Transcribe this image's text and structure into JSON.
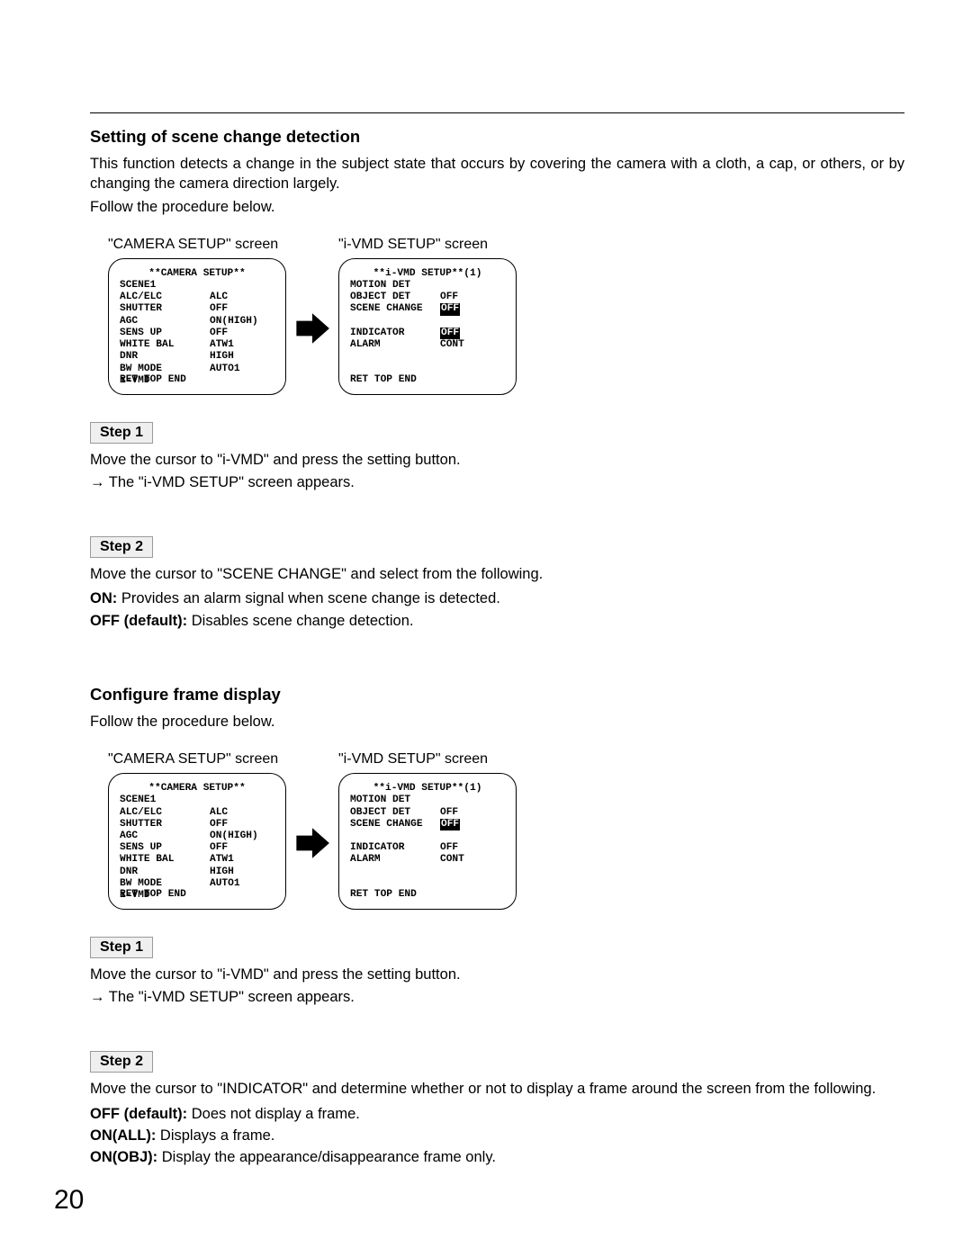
{
  "pageNumber": "20",
  "section1": {
    "title": "Setting of scene change detection",
    "intro1": "This function detects a change in the subject state that occurs by covering the camera with a cloth, a cap, or others, or by changing the camera direction largely.",
    "intro2": "Follow the procedure below.",
    "screenLabel1": "\"CAMERA SETUP\" screen",
    "screenLabel2": "\"i-VMD SETUP\" screen",
    "camScreen": {
      "title": "**CAMERA SETUP**",
      "scene": "SCENE1",
      "rows": [
        {
          "label": "ALC/ELC",
          "value": "ALC",
          "link": true,
          "hl": false
        },
        {
          "label": "SHUTTER",
          "value": "OFF",
          "link": false,
          "hl": false
        },
        {
          "label": "AGC",
          "value": "ON(HIGH)",
          "link": false,
          "hl": false
        },
        {
          "label": "SENS UP",
          "value": "OFF",
          "link": false,
          "hl": false
        },
        {
          "label": "WHITE BAL",
          "value": "ATW1",
          "link": true,
          "hl": false
        },
        {
          "label": "DNR",
          "value": "HIGH",
          "link": false,
          "hl": false
        },
        {
          "label": "BW MODE",
          "value": "AUTO1",
          "link": true,
          "hl": false
        },
        {
          "label": "i-VMD",
          "value": "",
          "link": true,
          "hl": false
        }
      ],
      "nav": "RET TOP END"
    },
    "ivmdScreen": {
      "title": "**i-VMD SETUP**(1)",
      "rows": [
        {
          "label": "MOTION DET",
          "value": "",
          "link": true,
          "hl": false
        },
        {
          "label": "OBJECT DET",
          "value": "OFF",
          "link": false,
          "hl": false
        },
        {
          "label": "SCENE CHANGE",
          "value": "OFF",
          "link": false,
          "hl": true
        },
        {
          "label": "",
          "value": "",
          "link": false,
          "hl": false
        },
        {
          "label": "INDICATOR",
          "value": "OFF",
          "link": false,
          "hl": true
        },
        {
          "label": "ALARM",
          "value": "CONT",
          "link": false,
          "hl": false
        }
      ],
      "nav": "RET TOP END"
    },
    "step1Label": "Step 1",
    "step1Text": "Move the cursor to \"i-VMD\" and press the setting button.",
    "step1Result": " The \"i-VMD SETUP\" screen appears.",
    "step2Label": "Step 2",
    "step2Text": "Move the cursor to \"SCENE CHANGE\" and select from the following.",
    "opt1Label": "ON:",
    "opt1Text": " Provides an alarm signal when scene change is detected.",
    "opt2Label": "OFF (default):",
    "opt2Text": " Disables scene change detection."
  },
  "section2": {
    "title": "Configure frame display",
    "intro1": "Follow the procedure below.",
    "screenLabel1": "\"CAMERA SETUP\" screen",
    "screenLabel2": "\"i-VMD SETUP\" screen",
    "camScreen": {
      "title": "**CAMERA SETUP**",
      "scene": "SCENE1",
      "rows": [
        {
          "label": "ALC/ELC",
          "value": "ALC",
          "link": true,
          "hl": false
        },
        {
          "label": "SHUTTER",
          "value": "OFF",
          "link": false,
          "hl": false
        },
        {
          "label": "AGC",
          "value": "ON(HIGH)",
          "link": false,
          "hl": false
        },
        {
          "label": "SENS UP",
          "value": "OFF",
          "link": false,
          "hl": false
        },
        {
          "label": "WHITE BAL",
          "value": "ATW1",
          "link": true,
          "hl": false
        },
        {
          "label": "DNR",
          "value": "HIGH",
          "link": false,
          "hl": false
        },
        {
          "label": "BW MODE",
          "value": "AUTO1",
          "link": true,
          "hl": false
        },
        {
          "label": "i-VMD",
          "value": "",
          "link": true,
          "hl": false
        }
      ],
      "nav": "RET TOP END"
    },
    "ivmdScreen": {
      "title": "**i-VMD SETUP**(1)",
      "rows": [
        {
          "label": "MOTION DET",
          "value": "",
          "link": true,
          "hl": false
        },
        {
          "label": "OBJECT DET",
          "value": "OFF",
          "link": false,
          "hl": false
        },
        {
          "label": "SCENE CHANGE",
          "value": "OFF",
          "link": false,
          "hl": true
        },
        {
          "label": "",
          "value": "",
          "link": false,
          "hl": false
        },
        {
          "label": "INDICATOR",
          "value": "OFF",
          "link": false,
          "hl": false
        },
        {
          "label": "ALARM",
          "value": "CONT",
          "link": false,
          "hl": false
        }
      ],
      "nav": "RET TOP END"
    },
    "step1Label": "Step 1",
    "step1Text": "Move the cursor to \"i-VMD\" and press the setting button.",
    "step1Result": " The \"i-VMD SETUP\" screen appears.",
    "step2Label": "Step 2",
    "step2Text": "Move the cursor to \"INDICATOR\" and determine whether or not to display a frame around the screen from the following.",
    "opt1Label": "OFF (default):",
    "opt1Text": " Does not display a frame.",
    "opt2Label": "ON(ALL):",
    "opt2Text": " Displays a frame.",
    "opt3Label": "ON(OBJ):",
    "opt3Text": " Display the appearance/disappearance frame only."
  },
  "arrowChar": "→"
}
